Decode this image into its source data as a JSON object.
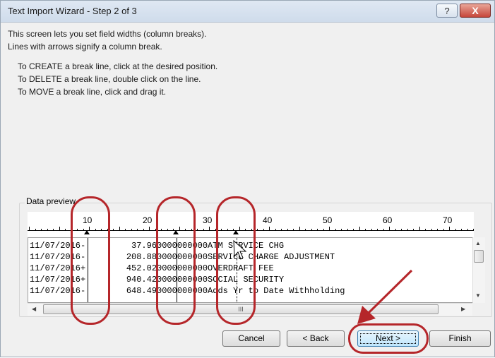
{
  "window": {
    "title": "Text Import Wizard - Step 2 of 3",
    "help_label": "?",
    "close_label": "X"
  },
  "intro": {
    "line1": "This screen lets you set field widths (column breaks).",
    "line2": "Lines with arrows signify a column break."
  },
  "instructions": {
    "create": "To CREATE a break line, click at the desired position.",
    "delete": "To DELETE a break line, double click on the line.",
    "move": "To MOVE a break line, click and drag it."
  },
  "data_preview": {
    "label": "Data preview",
    "ruler_numbers": [
      "10",
      "20",
      "30",
      "40",
      "50",
      "60",
      "70"
    ],
    "rows": [
      "11/07/2016-         37.960000000000ATM SERVICE CHG",
      "11/07/2016-        208.880000000000SERVICE CHARGE ADJUSTMENT",
      "11/07/2016+        452.020000000000OVERDRAFT FEE",
      "11/07/2016+        940.420000000000SOCIAL SECURITY",
      "11/07/2016-        648.490000000000Adds Yr to Date Withholding"
    ],
    "hscroll_grip": "III"
  },
  "buttons": {
    "cancel": "Cancel",
    "back": "< Back",
    "next": "Next >",
    "finish": "Finish"
  },
  "colors": {
    "annotation": "#b5262a",
    "default_button": "#bee6fd"
  }
}
